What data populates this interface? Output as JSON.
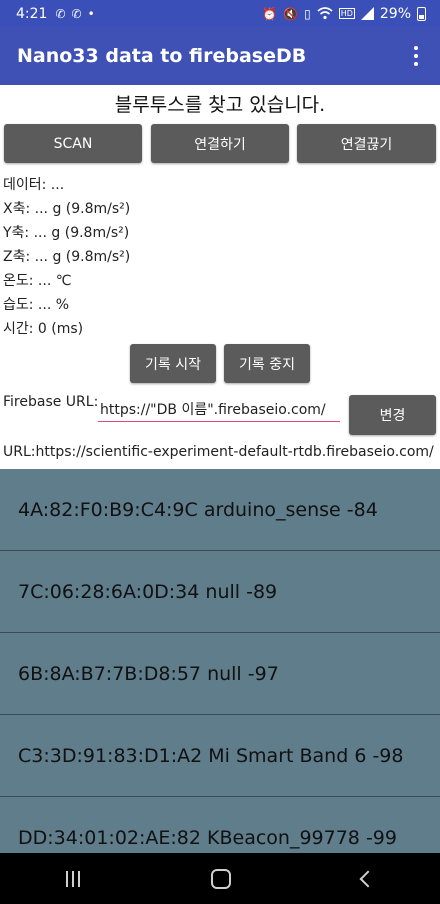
{
  "status_bar": {
    "time": "4:21",
    "battery": "29%"
  },
  "app_bar": {
    "title": "Nano33 data to firebaseDB"
  },
  "status_message": "블루투스를 찾고 있습니다.",
  "buttons": {
    "scan": "SCAN",
    "connect": "연결하기",
    "disconnect": "연결끊기",
    "record_start": "기록 시작",
    "record_stop": "기록 중지",
    "change": "변경"
  },
  "readings": [
    "데이터:  ...",
    "X축: ... g (9.8m/s²)",
    "Y축: ... g (9.8m/s²)",
    "Z축: ... g (9.8m/s²)",
    "온도: ... ℃",
    "습도: ... %",
    "시간: 0 (ms)"
  ],
  "firebase": {
    "label": "Firebase URL:",
    "input_value": "https://\"DB 이름\".firebaseio.com/",
    "current_url": "URL:https://scientific-experiment-default-rtdb.firebaseio.com/"
  },
  "devices": [
    "4A:82:F0:B9:C4:9C arduino_sense -84",
    "7C:06:28:6A:0D:34 null -89",
    "6B:8A:B7:7B:D8:57 null -97",
    "C3:3D:91:83:D1:A2 Mi Smart Band 6 -98",
    "DD:34:01:02:AE:82 KBeacon_99778 -99"
  ],
  "colors": {
    "status_bar": "#3b4fb8",
    "app_bar": "#3f51b5",
    "button": "#5b5b5b",
    "list_background": "#607d8b",
    "input_underline": "#e0488a"
  },
  "icons": {
    "status_left": [
      "phone-missed-icon",
      "phone-missed-icon",
      "dot-icon"
    ],
    "status_right": [
      "alarm-icon",
      "mute-icon",
      "no-sim-icon",
      "wifi-icon",
      "volte-icon",
      "signal-icon",
      "battery-icon"
    ],
    "app_menu": "overflow-menu-icon",
    "nav": [
      "recent-apps-icon",
      "home-icon",
      "back-icon"
    ]
  }
}
